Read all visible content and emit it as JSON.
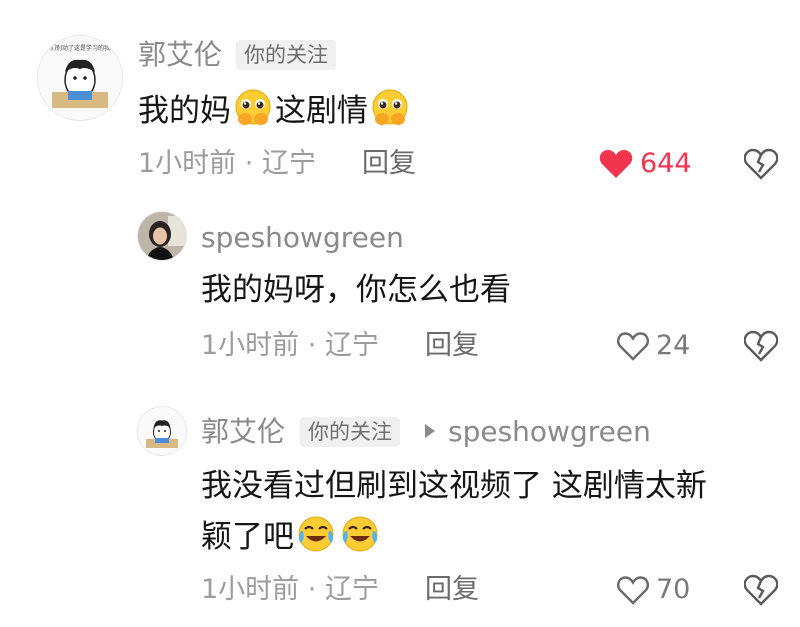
{
  "comments": [
    {
      "author": "郭艾伦",
      "badge": "你的关注",
      "text_parts": [
        "我的妈",
        "这剧情"
      ],
      "time": "1小时前",
      "location": "辽宁",
      "reply_label": "回复",
      "likes": "644",
      "liked": true,
      "emoji": "pleading-hands-emoji"
    },
    {
      "author": "speshowgreen",
      "text": "我的妈呀，你怎么也看",
      "time": "1小时前",
      "location": "辽宁",
      "reply_label": "回复",
      "likes": "24",
      "liked": false
    },
    {
      "author": "郭艾伦",
      "badge": "你的关注",
      "reply_to": "speshowgreen",
      "text_line1": "我没看过但刷到这视频了 这剧情太新",
      "text_line2": "颖了吧",
      "time": "1小时前",
      "location": "辽宁",
      "reply_label": "回复",
      "likes": "70",
      "liked": false,
      "emoji": "crying-laughing-emoji"
    }
  ],
  "avatar_caption": "你们别动了这是学习的我...",
  "meta_separator": "·",
  "colors": {
    "like_active": "#f2354f",
    "text_primary": "#161616",
    "text_secondary": "#9c9c9c"
  },
  "icons": [
    "heart-icon",
    "dislike-broken-heart-icon",
    "reply-arrow-icon"
  ]
}
